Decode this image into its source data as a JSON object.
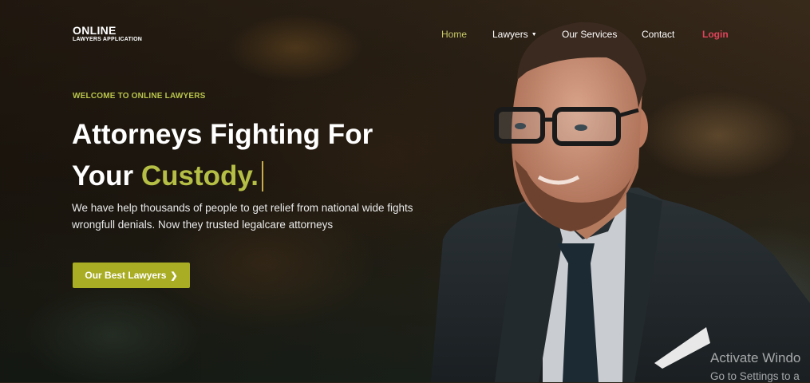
{
  "logo": {
    "main": "ONLINE",
    "sub": "LAWYERS APPLICATION"
  },
  "nav": {
    "items": [
      {
        "label": "Home",
        "active": true
      },
      {
        "label": "Lawyers",
        "has_dropdown": true
      },
      {
        "label": "Our Services"
      },
      {
        "label": "Contact"
      },
      {
        "label": "Login"
      }
    ]
  },
  "hero": {
    "kicker": "WELCOME TO ONLINE LAWYERS",
    "title_line1": "Attorneys Fighting For",
    "title_line2_prefix": "Your ",
    "title_highlight": "Custody.",
    "description": "We have help thousands of people to get relief from national wide fights wrongfull denials. Now they trusted legalcare attorneys",
    "cta_label": "Our Best Lawyers",
    "cta_icon": "chevron-right-icon"
  },
  "watermark": {
    "line1": "Activate Windo",
    "line2": "Go to Settings to a"
  },
  "colors": {
    "accent": "#b5be45",
    "button": "#a9ad24",
    "login": "#e0435a",
    "nav_active": "#c8c96a"
  }
}
